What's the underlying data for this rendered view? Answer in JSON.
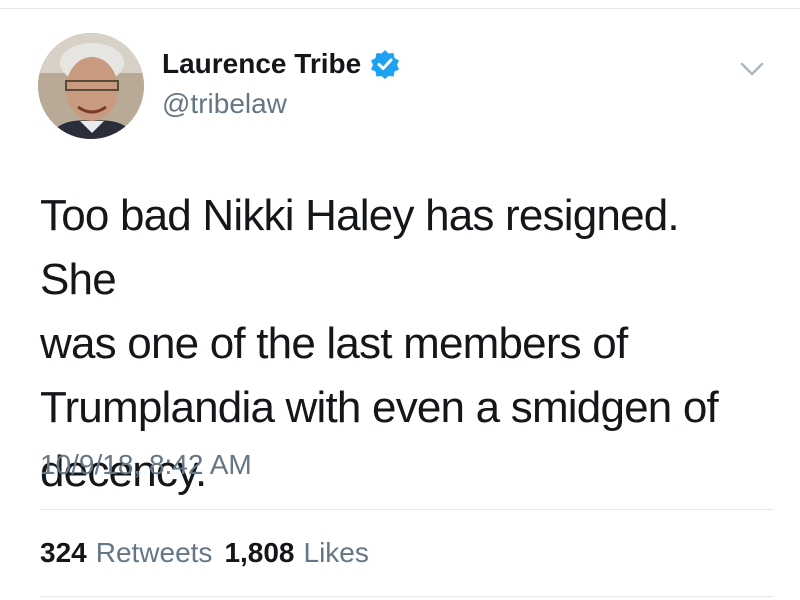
{
  "author": {
    "display_name": "Laurence Tribe",
    "handle": "@tribelaw",
    "verified": true,
    "avatar_icon": "person-photo"
  },
  "tweet": {
    "text": "Too bad Nikki Haley has resigned. She\nwas one of the last members of\nTrumplandia with even a smidgen of\ndecency.",
    "timestamp": "10/9/18, 8:42 AM"
  },
  "stats": {
    "retweets_count": "324",
    "retweets_label": "Retweets",
    "likes_count": "1,808",
    "likes_label": "Likes"
  },
  "colors": {
    "text": "#14171a",
    "secondary": "#657786",
    "verified_badge": "#1da1f2",
    "divider": "#e1e8ed"
  }
}
